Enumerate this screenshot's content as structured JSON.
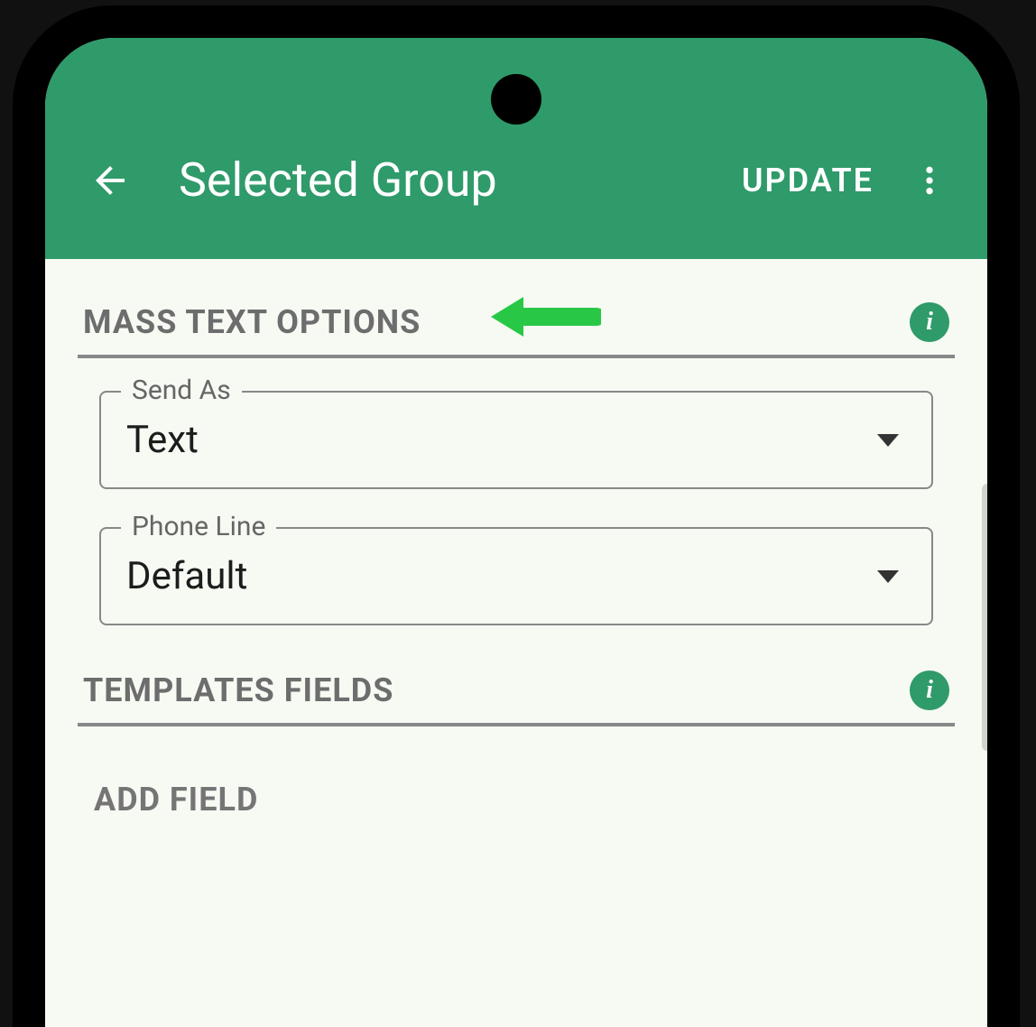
{
  "appbar": {
    "title": "Selected Group",
    "update_label": "UPDATE"
  },
  "sections": {
    "mass_text": {
      "title": "MASS TEXT OPTIONS",
      "send_as": {
        "label": "Send As",
        "value": "Text"
      },
      "phone_line": {
        "label": "Phone Line",
        "value": "Default"
      }
    },
    "templates": {
      "title": "TEMPLATES FIELDS",
      "add_field_label": "ADD FIELD"
    }
  },
  "icons": {
    "info": "i"
  },
  "colors": {
    "primary": "#2F9A6A",
    "background": "#f6faf3",
    "annotation_arrow": "#28c846"
  }
}
